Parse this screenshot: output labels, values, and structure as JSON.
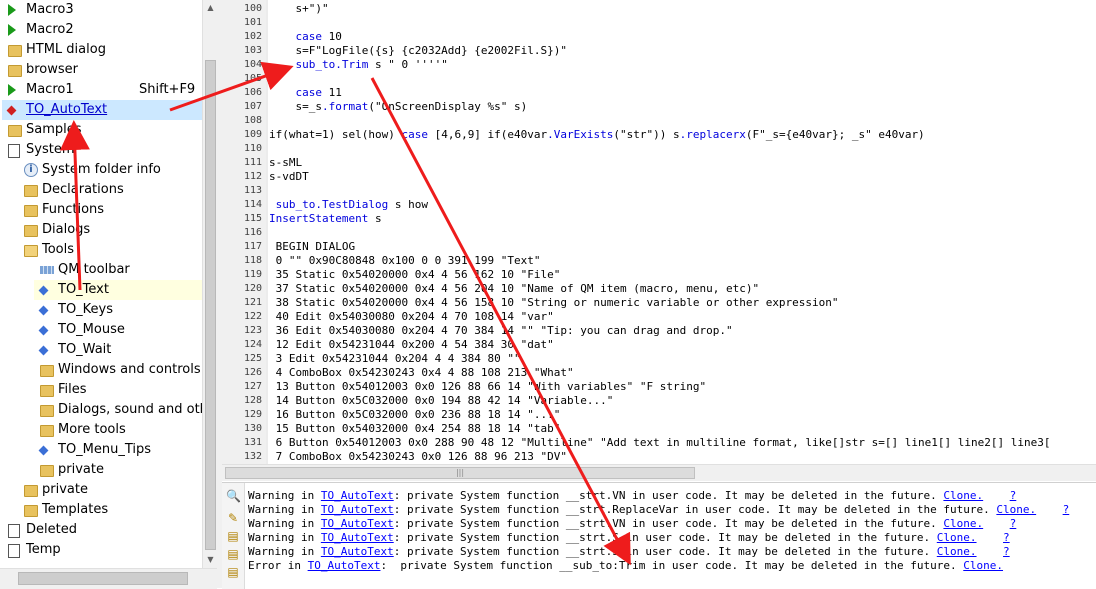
{
  "tree": {
    "items": [
      {
        "label": "Macro3",
        "icon": "macro-play-icon",
        "indent": 0
      },
      {
        "label": "Macro2",
        "icon": "macro-play-icon",
        "indent": 0
      },
      {
        "label": "HTML dialog",
        "icon": "folder-icon",
        "indent": 0
      },
      {
        "label": "browser",
        "icon": "folder-icon",
        "indent": 0
      },
      {
        "label": "Macro1",
        "icon": "macro-play-icon",
        "indent": 0,
        "shortcut": "Shift+F9"
      },
      {
        "label": "TO_AutoText",
        "icon": "autotext-icon",
        "indent": 0,
        "selected": true
      },
      {
        "label": "Samples",
        "icon": "folder-icon",
        "indent": 0
      },
      {
        "label": "System",
        "icon": "system-icon",
        "indent": 0
      },
      {
        "label": "System folder info",
        "icon": "info-icon",
        "indent": 1
      },
      {
        "label": "Declarations",
        "icon": "folder-icon",
        "indent": 1
      },
      {
        "label": "Functions",
        "icon": "folder-icon",
        "indent": 1
      },
      {
        "label": "Dialogs",
        "icon": "folder-icon",
        "indent": 1
      },
      {
        "label": "Tools",
        "icon": "folder-open-icon",
        "indent": 1
      },
      {
        "label": "QM toolbar",
        "icon": "toolbar-icon",
        "indent": 2
      },
      {
        "label": "TO_Text",
        "icon": "function-icon",
        "indent": 2,
        "highlight": true
      },
      {
        "label": "TO_Keys",
        "icon": "function-icon",
        "indent": 2
      },
      {
        "label": "TO_Mouse",
        "icon": "function-icon",
        "indent": 2
      },
      {
        "label": "TO_Wait",
        "icon": "function-icon",
        "indent": 2
      },
      {
        "label": "Windows and controls",
        "icon": "folder-icon",
        "indent": 2
      },
      {
        "label": "Files",
        "icon": "folder-icon",
        "indent": 2
      },
      {
        "label": "Dialogs, sound and othe",
        "icon": "folder-icon",
        "indent": 2
      },
      {
        "label": "More tools",
        "icon": "folder-icon",
        "indent": 2
      },
      {
        "label": "TO_Menu_Tips",
        "icon": "menu-icon",
        "indent": 2
      },
      {
        "label": "private",
        "icon": "folder-icon",
        "indent": 2
      },
      {
        "label": "private",
        "icon": "folder-icon",
        "indent": 1
      },
      {
        "label": "Templates",
        "icon": "folder-icon",
        "indent": 1
      },
      {
        "label": "Deleted",
        "icon": "system-icon",
        "indent": 0
      },
      {
        "label": "Temp",
        "icon": "system-icon",
        "indent": 0
      }
    ]
  },
  "editor": {
    "lines": [
      {
        "n": "100",
        "text": "    s+\")\""
      },
      {
        "n": "101",
        "text": ""
      },
      {
        "n": "102",
        "text": "    case 10"
      },
      {
        "n": "103",
        "text": "    s=F\"LogFile({s} {c2032Add} {e2002Fil.S})\""
      },
      {
        "n": "104",
        "text": "    sub_to.Trim s \" 0 ''''\""
      },
      {
        "n": "105",
        "text": ""
      },
      {
        "n": "106",
        "text": "    case 11"
      },
      {
        "n": "107",
        "text": "    s=_s.format(\"OnScreenDisplay %s\" s)"
      },
      {
        "n": "108",
        "text": ""
      },
      {
        "n": "109",
        "text": "if(what=1) sel(how) case [4,6,9] if(e40var.VarExists(\"str\")) s.replacerx(F\"_s={e40var}; _s\" e40var)"
      },
      {
        "n": "110",
        "text": ""
      },
      {
        "n": "111",
        "text": "s-sML"
      },
      {
        "n": "112",
        "text": "s-vdDT"
      },
      {
        "n": "113",
        "text": ""
      },
      {
        "n": "114",
        "text": " sub_to.TestDialog s how"
      },
      {
        "n": "115",
        "text": "InsertStatement s"
      },
      {
        "n": "116",
        "text": ""
      },
      {
        "n": "117",
        "text": " BEGIN DIALOG"
      },
      {
        "n": "118",
        "text": " 0 \"\" 0x90C80848 0x100 0 0 391 199 \"Text\""
      },
      {
        "n": "119",
        "text": " 35 Static 0x54020000 0x4 4 56 162 10 \"File\""
      },
      {
        "n": "120",
        "text": " 37 Static 0x54020000 0x4 4 56 204 10 \"Name of QM item (macro, menu, etc)\""
      },
      {
        "n": "121",
        "text": " 38 Static 0x54020000 0x4 4 56 158 10 \"String or numeric variable or other expression\""
      },
      {
        "n": "122",
        "text": " 40 Edit 0x54030080 0x204 4 70 108 14 \"var\""
      },
      {
        "n": "123",
        "text": " 36 Edit 0x54030080 0x204 4 70 384 14 \"\" \"Tip: you can drag and drop.\""
      },
      {
        "n": "124",
        "text": " 12 Edit 0x54231044 0x200 4 54 384 30 \"dat\""
      },
      {
        "n": "125",
        "text": " 3 Edit 0x54231044 0x204 4 4 384 80 \"\""
      },
      {
        "n": "126",
        "text": " 4 ComboBox 0x54230243 0x4 4 88 108 213 \"What\""
      },
      {
        "n": "127",
        "text": " 13 Button 0x54012003 0x0 126 88 66 14 \"With variables\" \"F string\""
      },
      {
        "n": "128",
        "text": " 14 Button 0x5C032000 0x0 194 88 42 14 \"Variable...\""
      },
      {
        "n": "129",
        "text": " 16 Button 0x5C032000 0x0 236 88 18 14 \"...\""
      },
      {
        "n": "130",
        "text": " 15 Button 0x54032000 0x4 254 88 18 14 \"tab\""
      },
      {
        "n": "131",
        "text": " 6 Button 0x54012003 0x0 288 90 48 12 \"Multiline\" \"Add text in multiline format, like[]str s=[] line1[] line2[] line3["
      },
      {
        "n": "132",
        "text": " 7 ComboBox 0x54230243 0x0 126 88 96 213 \"DV\""
      }
    ]
  },
  "output": {
    "lines": [
      {
        "type": "Warning",
        "pre": "Warning in ",
        "item": "TO_AutoText",
        "msg": ": private System function __strt.VN in user code. It may be deleted in the future. ",
        "action": "Clone.",
        "help": "?"
      },
      {
        "type": "Warning",
        "pre": "Warning in ",
        "item": "TO_AutoText",
        "msg": ": private System function __strt.ReplaceVar in user code. It may be deleted in the future. ",
        "action": "Clone.",
        "help": "?"
      },
      {
        "type": "Warning",
        "pre": "Warning in ",
        "item": "TO_AutoText",
        "msg": ": private System function __strt.VN in user code. It may be deleted in the future. ",
        "action": "Clone.",
        "help": "?"
      },
      {
        "type": "Warning",
        "pre": "Warning in ",
        "item": "TO_AutoText",
        "msg": ": private System function __strt.S in user code. It may be deleted in the future. ",
        "action": "Clone.",
        "help": "?"
      },
      {
        "type": "Warning",
        "pre": "Warning in ",
        "item": "TO_AutoText",
        "msg": ": private System function __strt.S in user code. It may be deleted in the future. ",
        "action": "Clone.",
        "help": "?"
      },
      {
        "type": "Error",
        "pre": "Error in ",
        "item": "TO_AutoText",
        "msg": ":  private System function __sub_to:Trim in user code. It may be deleted in the future. ",
        "action": "Clone.",
        "help": ""
      }
    ]
  },
  "colors": {
    "selection": "#cce8ff",
    "highlight": "#ffffe0",
    "keyword": "#0000dd",
    "link": "#0000ff",
    "arrow": "#ee1c1c"
  }
}
